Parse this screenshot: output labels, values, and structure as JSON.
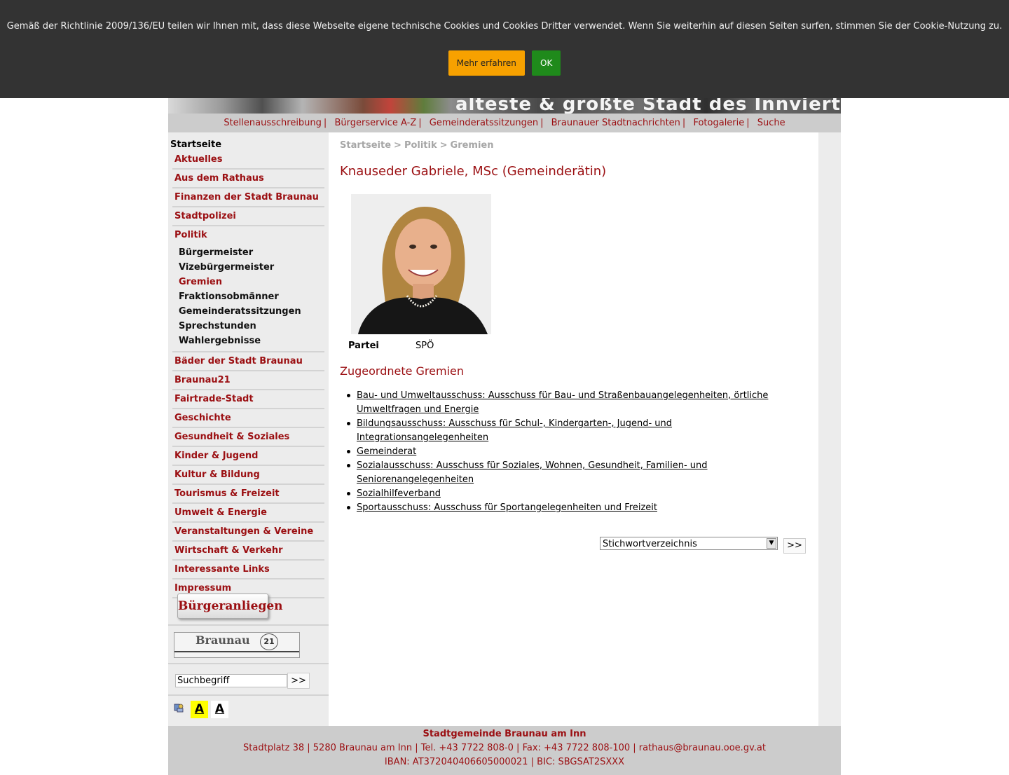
{
  "cookie_banner": {
    "text": "Gemäß der Richtlinie 2009/136/EU teilen wir Ihnen mit, dass diese Webseite eigene technische Cookies und Cookies Dritter verwendet. Wenn Sie weiterhin auf diesen Seiten surfen, stimmen Sie der Cookie-Nutzung zu.",
    "more_label": "Mehr erfahren",
    "ok_label": "OK"
  },
  "header": {
    "slogan": "älteste & größte Stadt des Innviertels"
  },
  "topnav": {
    "items": [
      "Stellenausschreibung",
      "Bürgerservice A-Z",
      "Gemeinderatssitzungen",
      "Braunauer Stadtnachrichten",
      "Fotogalerie",
      "Suche"
    ],
    "separator": "|"
  },
  "sidebar": {
    "home": "Startseite",
    "menu_top": [
      "Aktuelles",
      "Aus dem Rathaus",
      "Finanzen der Stadt Braunau",
      "Stadtpolizei",
      "Politik"
    ],
    "submenu": [
      "Bürgermeister",
      "Vizebürgermeister",
      "Gremien",
      "Fraktionsobmänner",
      "Gemeinderatssitzungen",
      "Sprechstunden",
      "Wahlergebnisse"
    ],
    "menu_bottom": [
      "Bäder der Stadt Braunau",
      "Braunau21",
      "Fairtrade-Stadt",
      "Geschichte",
      "Gesundheit & Soziales",
      "Kinder & Jugend",
      "Kultur & Bildung",
      "Tourismus & Freizeit",
      "Umwelt & Energie",
      "Veranstaltungen & Vereine",
      "Wirtschaft & Verkehr",
      "Interessante Links",
      "Impressum"
    ],
    "anliegen_button": "Bürgeranliegen",
    "braunau21_logo_text": "Braunau",
    "braunau21_logo_number": "21",
    "search_value": "Suchbegriff",
    "search_button": ">>",
    "contrast_a": "A",
    "contrast_b": "A"
  },
  "content": {
    "breadcrumb": [
      "Startseite",
      "Politik",
      "Gremien"
    ],
    "breadcrumb_sep": ">",
    "title": "Knauseder Gabriele, MSc (Gemeinderätin)",
    "party_label": "Partei",
    "party_value": "SPÖ",
    "section_title": "Zugeordnete Gremien",
    "gremien": [
      "Bau- und Umweltausschuss: Ausschuss für Bau- und Straßenbauangelegenheiten, örtliche Umweltfragen und Energie",
      "Bildungsausschuss: Ausschuss für Schul-, Kindergarten-, Jugend- und Integrationsangelegenheiten",
      "Gemeinderat",
      "Sozialausschuss: Ausschuss für Soziales, Wohnen, Gesundheit, Familien- und Seniorenangelegenheiten",
      "Sozialhilfeverband",
      "Sportausschuss: Ausschuss für Sportangelegenheiten und Freizeit"
    ],
    "stichwort_select": "Stichwortverzeichnis",
    "stichwort_button": ">>"
  },
  "footer": {
    "line1": "Stadtgemeinde Braunau am Inn",
    "line2": "Stadtplatz 38 | 5280 Braunau am Inn | Tel. +43 7722 808-0 | Fax: +43 7722 808-100 | rathaus@braunau.ooe.gv.at",
    "line3": "IBAN: AT372040406605000021 | BIC: SBGSAT2SXXX"
  },
  "colors": {
    "brand_red": "#9b0f12",
    "banner_bg": "#333333",
    "more_button": "#f7a100",
    "ok_button": "#1f8a1b"
  }
}
